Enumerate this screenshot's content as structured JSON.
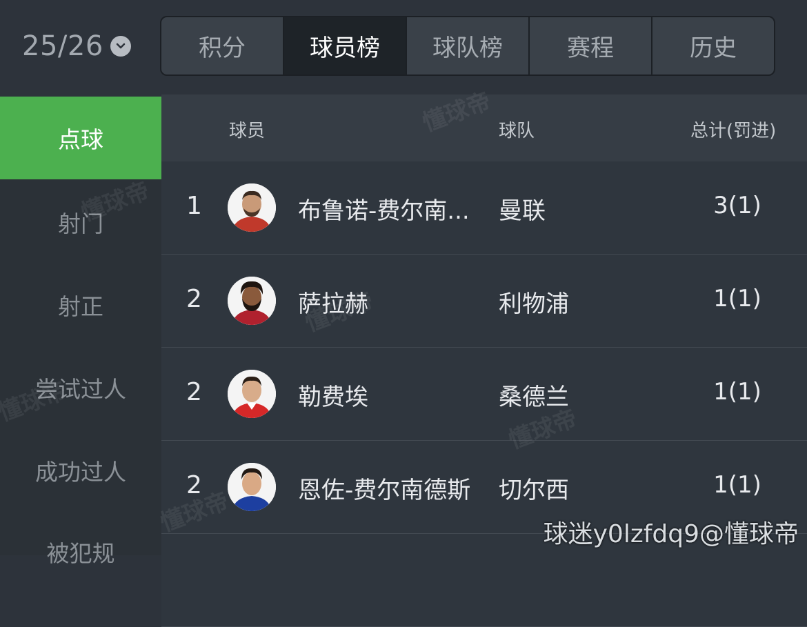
{
  "header": {
    "season": "25/26",
    "tabs": [
      "积分",
      "球员榜",
      "球队榜",
      "赛程",
      "历史"
    ],
    "active_tab": "球员榜"
  },
  "sidebar": {
    "items": [
      "点球",
      "射门",
      "射正",
      "尝试过人",
      "成功过人",
      "被犯规"
    ],
    "active": "点球"
  },
  "table": {
    "headers": {
      "player": "球员",
      "team": "球队",
      "total": "总计(罚进)"
    },
    "rows": [
      {
        "rank": "1",
        "player": "布鲁诺-费尔南...",
        "team": "曼联",
        "total": "3(1)"
      },
      {
        "rank": "2",
        "player": "萨拉赫",
        "team": "利物浦",
        "total": "1(1)"
      },
      {
        "rank": "2",
        "player": "勒费埃",
        "team": "桑德兰",
        "total": "1(1)"
      },
      {
        "rank": "2",
        "player": "恩佐-费尔南德斯",
        "team": "切尔西",
        "total": "1(1)"
      }
    ]
  },
  "watermark": "懂球帝",
  "credit": "球迷y0lzfdq9@懂球帝",
  "colors": {
    "accent": "#4cb04f",
    "background": "#2d333b",
    "row": "#2f363e"
  }
}
